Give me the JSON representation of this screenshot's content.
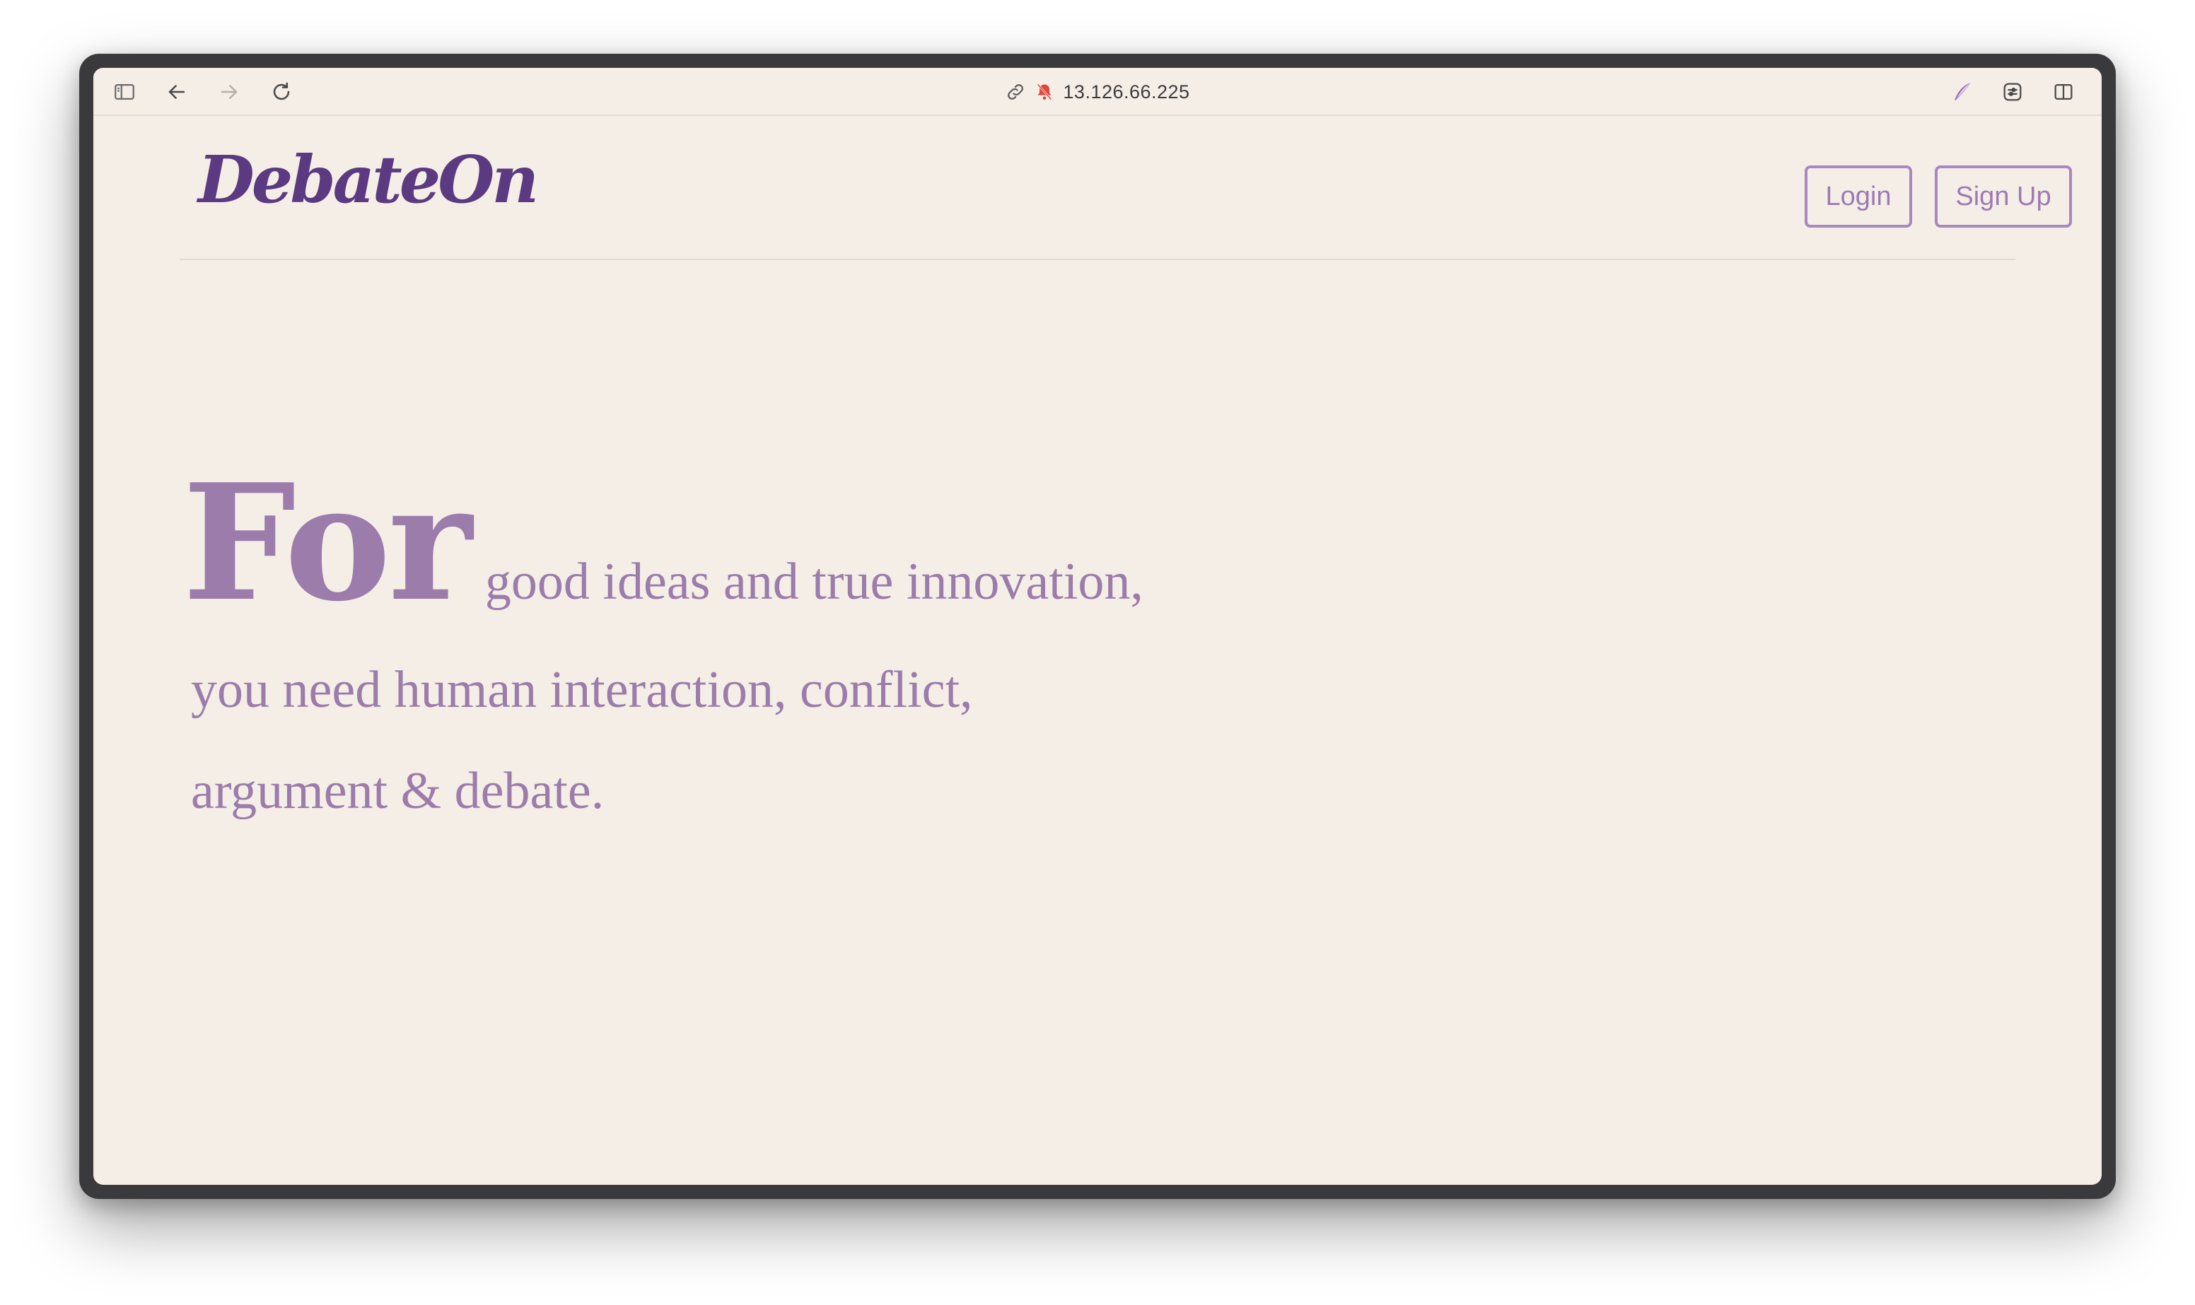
{
  "browser": {
    "url": "13.126.66.225",
    "icons": {
      "sidebar": "sidebar-icon",
      "back": "back-arrow-icon",
      "forward": "forward-arrow-icon",
      "reload": "reload-icon",
      "link": "link-icon",
      "notification": "notification-blocked-icon",
      "extension": "quill-icon",
      "settings": "page-settings-icon",
      "split": "split-view-icon"
    }
  },
  "header": {
    "logo": "DebateOn",
    "login_label": "Login",
    "signup_label": "Sign Up"
  },
  "hero": {
    "big_word": "For",
    "line1_rest": "good ideas and true innovation,",
    "line2": "you need human interaction, conflict,",
    "line3": "argument & debate."
  },
  "colors": {
    "background": "#f5eee6",
    "brand": "#5b3a82",
    "accent": "#9b7cab",
    "button_border": "#a887c2"
  }
}
